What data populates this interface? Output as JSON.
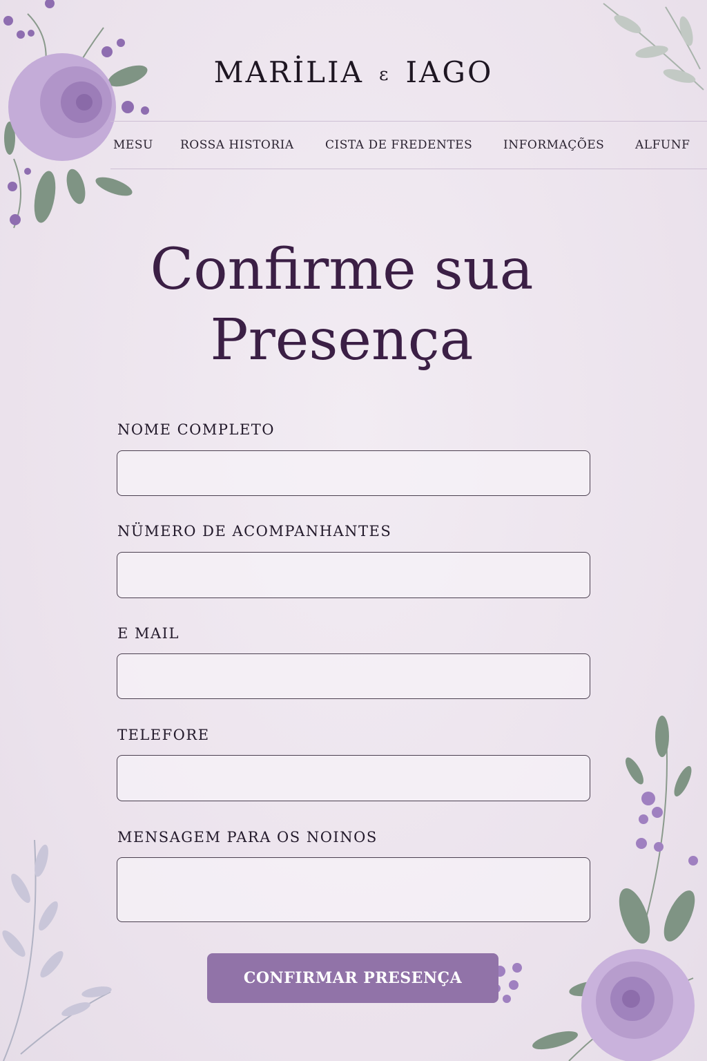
{
  "header": {
    "name_left": "MARİLIA",
    "ampersand": "ε",
    "name_right": "IAGO"
  },
  "nav": {
    "items": [
      "MESU",
      "ROSSA HISTORIA",
      "CISTA DE FREDENTES",
      "INFORMAÇÕES",
      "ALFUNF"
    ]
  },
  "page": {
    "title_line1": "Confirme sua",
    "title_line2": "Presença"
  },
  "form": {
    "fields": [
      {
        "label": "NOME COMPLETO",
        "value": ""
      },
      {
        "label": "NÜMERO DE ACOMPANHANTES",
        "value": ""
      },
      {
        "label": "E MAIL",
        "value": ""
      },
      {
        "label": "TELEFORE",
        "value": ""
      },
      {
        "label": "MENSAGEM PARA OS NOINOS",
        "value": ""
      }
    ],
    "submit_label": "CONFIRMAR PRESENÇA"
  },
  "colors": {
    "background": "#efe7f0",
    "title": "#3b1f45",
    "button": "#9173a8",
    "rose": "#b89ccc",
    "leaf": "#7f9484"
  },
  "decorations": [
    "rose-cluster-icon",
    "leaf-branch-icon"
  ]
}
